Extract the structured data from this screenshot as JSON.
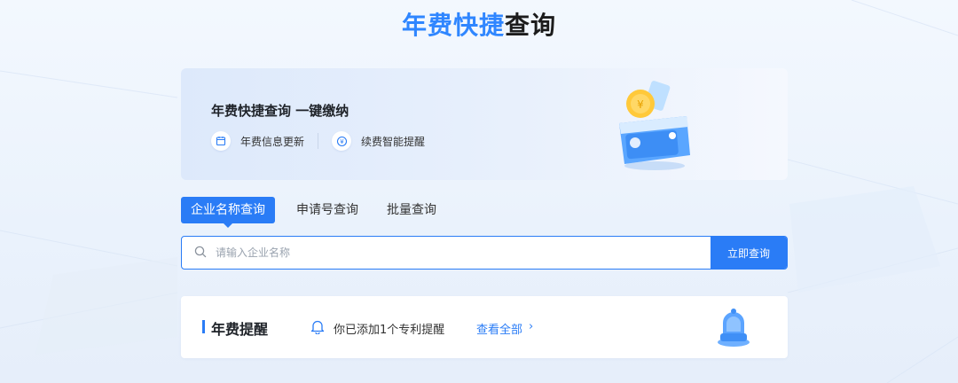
{
  "header": {
    "title_accent": "年费快捷",
    "title_rest": "查询"
  },
  "banner": {
    "heading": "年费快捷查询 一键缴纳",
    "features": [
      {
        "label": "年费信息更新",
        "icon": "calendar-icon"
      },
      {
        "label": "续费智能提醒",
        "icon": "renew-icon"
      }
    ]
  },
  "tabs": [
    {
      "label": "企业名称查询",
      "active": true
    },
    {
      "label": "申请号查询",
      "active": false
    },
    {
      "label": "批量查询",
      "active": false
    }
  ],
  "search": {
    "placeholder": "请输入企业名称",
    "value": "",
    "button_label": "立即查询"
  },
  "reminder": {
    "title": "年费提醒",
    "text": "你已添加1个专利提醒",
    "link": "查看全部",
    "chevron": "›"
  },
  "colors": {
    "accent": "#2a7cf6",
    "title_accent": "#2f86ff"
  }
}
